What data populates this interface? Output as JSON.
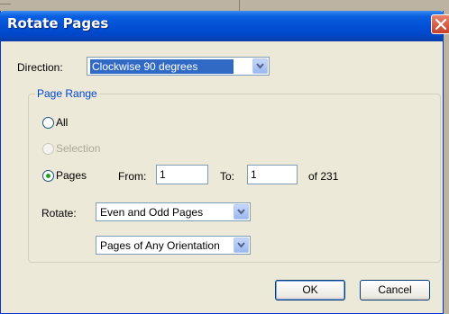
{
  "dialog": {
    "title": "Rotate Pages"
  },
  "direction": {
    "label": "Direction:",
    "selected": "Clockwise 90 degrees"
  },
  "page_range": {
    "legend": "Page Range",
    "all_label": "All",
    "selection_label": "Selection",
    "pages_label": "Pages",
    "from_label": "From:",
    "from_value": "1",
    "to_label": "To:",
    "to_value": "1",
    "of_text": "of 231",
    "rotate_label": "Rotate:",
    "parity_selected": "Even and Odd Pages",
    "orientation_selected": "Pages of Any Orientation"
  },
  "buttons": {
    "ok": "OK",
    "cancel": "Cancel"
  },
  "colors": {
    "title_bar": "#0450d6",
    "selection": "#316ac5",
    "legend": "#0046d5",
    "radio_dot": "#21a121"
  }
}
